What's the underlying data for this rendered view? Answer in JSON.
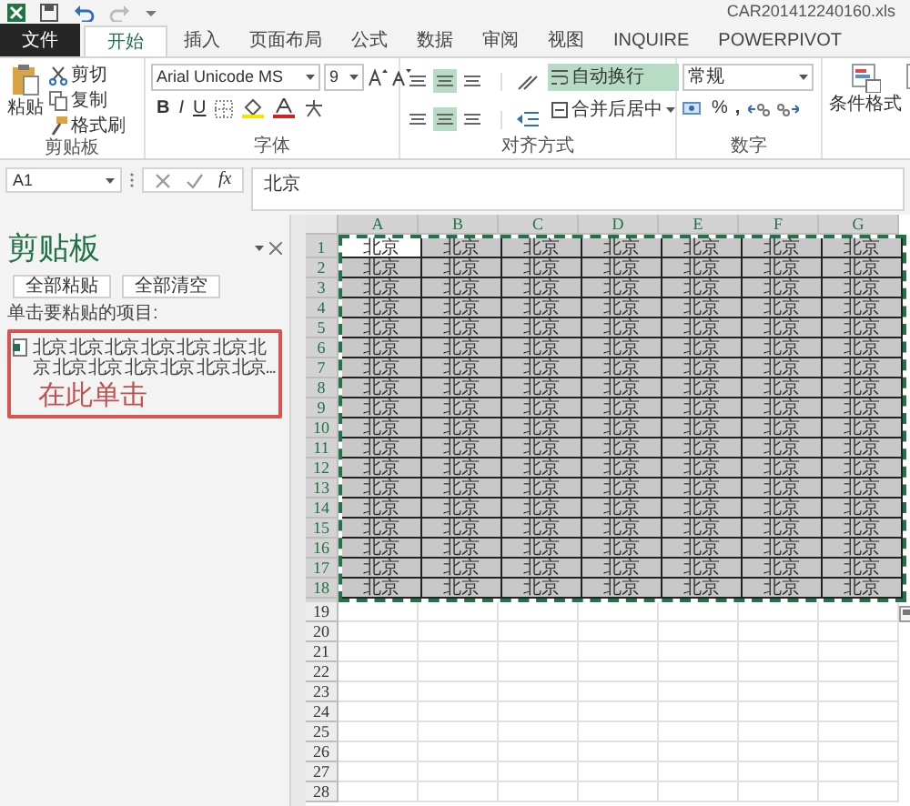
{
  "title_bar": {
    "title": "CAR201412240160.xls"
  },
  "tabs": [
    {
      "label": "文件",
      "kind": "file",
      "selected": false
    },
    {
      "label": "开始",
      "kind": "tab",
      "selected": true
    },
    {
      "label": "插入",
      "kind": "tab",
      "selected": false
    },
    {
      "label": "页面布局",
      "kind": "tab",
      "selected": false
    },
    {
      "label": "公式",
      "kind": "tab",
      "selected": false
    },
    {
      "label": "数据",
      "kind": "tab",
      "selected": false
    },
    {
      "label": "审阅",
      "kind": "tab",
      "selected": false
    },
    {
      "label": "视图",
      "kind": "tab",
      "selected": false
    },
    {
      "label": "INQUIRE",
      "kind": "tab",
      "selected": false
    },
    {
      "label": "POWERPIVOT",
      "kind": "tab",
      "selected": false
    }
  ],
  "ribbon": {
    "clipboard": {
      "paste": "粘贴",
      "cut": "剪切",
      "copy": "复制",
      "format_painter": "格式刷",
      "label": "剪贴板"
    },
    "font": {
      "name": "Arial Unicode MS",
      "size": "9",
      "bold": "B",
      "italic": "I",
      "underline": "U",
      "label": "字体"
    },
    "alignment": {
      "vertical": [
        {
          "selected": false
        },
        {
          "selected": true
        },
        {
          "selected": false
        }
      ],
      "horizontal": [
        {
          "selected": false
        },
        {
          "selected": true
        },
        {
          "selected": false
        }
      ],
      "wrap_text": "自动换行",
      "wrap_text_on": true,
      "merge": "合并后居中",
      "label": "对齐方式"
    },
    "number": {
      "format": "常规",
      "percent": "%",
      "comma": ",",
      "label": "数字"
    },
    "styles": {
      "conditional": "条件格式"
    }
  },
  "formula_bar": {
    "name_box": "A1",
    "function_label": "fx",
    "value": "北京"
  },
  "clipboard_pane": {
    "title": "剪贴板",
    "paste_all": "全部粘贴",
    "clear_all": "全部清空",
    "hint": "单击要粘贴的项目:",
    "items": [
      {
        "text": "北京 北京 北京 北京 北京 北京 北京 北京 北京 北京 北京 北京 北京..."
      }
    ],
    "annotation": "在此单击"
  },
  "sheet": {
    "columns": [
      "A",
      "B",
      "C",
      "D",
      "E",
      "F",
      "G"
    ],
    "rows": [
      {
        "header": "1",
        "cells": [
          {
            "text": "北京",
            "active": true
          },
          {
            "text": "北京",
            "active": false
          },
          {
            "text": "北京",
            "active": false
          },
          {
            "text": "北京",
            "active": false
          },
          {
            "text": "北京",
            "active": false
          },
          {
            "text": "北京",
            "active": false
          },
          {
            "text": "北京",
            "active": false
          }
        ]
      },
      {
        "header": "2",
        "cells": [
          {
            "text": "北京",
            "active": false
          },
          {
            "text": "北京",
            "active": false
          },
          {
            "text": "北京",
            "active": false
          },
          {
            "text": "北京",
            "active": false
          },
          {
            "text": "北京",
            "active": false
          },
          {
            "text": "北京",
            "active": false
          },
          {
            "text": "北京",
            "active": false
          }
        ]
      },
      {
        "header": "3",
        "cells": [
          {
            "text": "北京",
            "active": false
          },
          {
            "text": "北京",
            "active": false
          },
          {
            "text": "北京",
            "active": false
          },
          {
            "text": "北京",
            "active": false
          },
          {
            "text": "北京",
            "active": false
          },
          {
            "text": "北京",
            "active": false
          },
          {
            "text": "北京",
            "active": false
          }
        ]
      },
      {
        "header": "4",
        "cells": [
          {
            "text": "北京",
            "active": false
          },
          {
            "text": "北京",
            "active": false
          },
          {
            "text": "北京",
            "active": false
          },
          {
            "text": "北京",
            "active": false
          },
          {
            "text": "北京",
            "active": false
          },
          {
            "text": "北京",
            "active": false
          },
          {
            "text": "北京",
            "active": false
          }
        ]
      },
      {
        "header": "5",
        "cells": [
          {
            "text": "北京",
            "active": false
          },
          {
            "text": "北京",
            "active": false
          },
          {
            "text": "北京",
            "active": false
          },
          {
            "text": "北京",
            "active": false
          },
          {
            "text": "北京",
            "active": false
          },
          {
            "text": "北京",
            "active": false
          },
          {
            "text": "北京",
            "active": false
          }
        ]
      },
      {
        "header": "6",
        "cells": [
          {
            "text": "北京",
            "active": false
          },
          {
            "text": "北京",
            "active": false
          },
          {
            "text": "北京",
            "active": false
          },
          {
            "text": "北京",
            "active": false
          },
          {
            "text": "北京",
            "active": false
          },
          {
            "text": "北京",
            "active": false
          },
          {
            "text": "北京",
            "active": false
          }
        ]
      },
      {
        "header": "7",
        "cells": [
          {
            "text": "北京",
            "active": false
          },
          {
            "text": "北京",
            "active": false
          },
          {
            "text": "北京",
            "active": false
          },
          {
            "text": "北京",
            "active": false
          },
          {
            "text": "北京",
            "active": false
          },
          {
            "text": "北京",
            "active": false
          },
          {
            "text": "北京",
            "active": false
          }
        ]
      },
      {
        "header": "8",
        "cells": [
          {
            "text": "北京",
            "active": false
          },
          {
            "text": "北京",
            "active": false
          },
          {
            "text": "北京",
            "active": false
          },
          {
            "text": "北京",
            "active": false
          },
          {
            "text": "北京",
            "active": false
          },
          {
            "text": "北京",
            "active": false
          },
          {
            "text": "北京",
            "active": false
          }
        ]
      },
      {
        "header": "9",
        "cells": [
          {
            "text": "北京",
            "active": false
          },
          {
            "text": "北京",
            "active": false
          },
          {
            "text": "北京",
            "active": false
          },
          {
            "text": "北京",
            "active": false
          },
          {
            "text": "北京",
            "active": false
          },
          {
            "text": "北京",
            "active": false
          },
          {
            "text": "北京",
            "active": false
          }
        ]
      },
      {
        "header": "10",
        "cells": [
          {
            "text": "北京",
            "active": false
          },
          {
            "text": "北京",
            "active": false
          },
          {
            "text": "北京",
            "active": false
          },
          {
            "text": "北京",
            "active": false
          },
          {
            "text": "北京",
            "active": false
          },
          {
            "text": "北京",
            "active": false
          },
          {
            "text": "北京",
            "active": false
          }
        ]
      },
      {
        "header": "11",
        "cells": [
          {
            "text": "北京",
            "active": false
          },
          {
            "text": "北京",
            "active": false
          },
          {
            "text": "北京",
            "active": false
          },
          {
            "text": "北京",
            "active": false
          },
          {
            "text": "北京",
            "active": false
          },
          {
            "text": "北京",
            "active": false
          },
          {
            "text": "北京",
            "active": false
          }
        ]
      },
      {
        "header": "12",
        "cells": [
          {
            "text": "北京",
            "active": false
          },
          {
            "text": "北京",
            "active": false
          },
          {
            "text": "北京",
            "active": false
          },
          {
            "text": "北京",
            "active": false
          },
          {
            "text": "北京",
            "active": false
          },
          {
            "text": "北京",
            "active": false
          },
          {
            "text": "北京",
            "active": false
          }
        ]
      },
      {
        "header": "13",
        "cells": [
          {
            "text": "北京",
            "active": false
          },
          {
            "text": "北京",
            "active": false
          },
          {
            "text": "北京",
            "active": false
          },
          {
            "text": "北京",
            "active": false
          },
          {
            "text": "北京",
            "active": false
          },
          {
            "text": "北京",
            "active": false
          },
          {
            "text": "北京",
            "active": false
          }
        ]
      },
      {
        "header": "14",
        "cells": [
          {
            "text": "北京",
            "active": false
          },
          {
            "text": "北京",
            "active": false
          },
          {
            "text": "北京",
            "active": false
          },
          {
            "text": "北京",
            "active": false
          },
          {
            "text": "北京",
            "active": false
          },
          {
            "text": "北京",
            "active": false
          },
          {
            "text": "北京",
            "active": false
          }
        ]
      },
      {
        "header": "15",
        "cells": [
          {
            "text": "北京",
            "active": false
          },
          {
            "text": "北京",
            "active": false
          },
          {
            "text": "北京",
            "active": false
          },
          {
            "text": "北京",
            "active": false
          },
          {
            "text": "北京",
            "active": false
          },
          {
            "text": "北京",
            "active": false
          },
          {
            "text": "北京",
            "active": false
          }
        ]
      },
      {
        "header": "16",
        "cells": [
          {
            "text": "北京",
            "active": false
          },
          {
            "text": "北京",
            "active": false
          },
          {
            "text": "北京",
            "active": false
          },
          {
            "text": "北京",
            "active": false
          },
          {
            "text": "北京",
            "active": false
          },
          {
            "text": "北京",
            "active": false
          },
          {
            "text": "北京",
            "active": false
          }
        ]
      },
      {
        "header": "17",
        "cells": [
          {
            "text": "北京",
            "active": false
          },
          {
            "text": "北京",
            "active": false
          },
          {
            "text": "北京",
            "active": false
          },
          {
            "text": "北京",
            "active": false
          },
          {
            "text": "北京",
            "active": false
          },
          {
            "text": "北京",
            "active": false
          },
          {
            "text": "北京",
            "active": false
          }
        ]
      },
      {
        "header": "18",
        "cells": [
          {
            "text": "北京",
            "active": false
          },
          {
            "text": "北京",
            "active": false
          },
          {
            "text": "北京",
            "active": false
          },
          {
            "text": "北京",
            "active": false
          },
          {
            "text": "北京",
            "active": false
          },
          {
            "text": "北京",
            "active": false
          },
          {
            "text": "北京",
            "active": false
          }
        ]
      },
      {
        "header": "19"
      },
      {
        "header": "20"
      },
      {
        "header": "21"
      },
      {
        "header": "22"
      },
      {
        "header": "23"
      },
      {
        "header": "24"
      },
      {
        "header": "25"
      },
      {
        "header": "26"
      },
      {
        "header": "27"
      },
      {
        "header": "28"
      }
    ]
  }
}
